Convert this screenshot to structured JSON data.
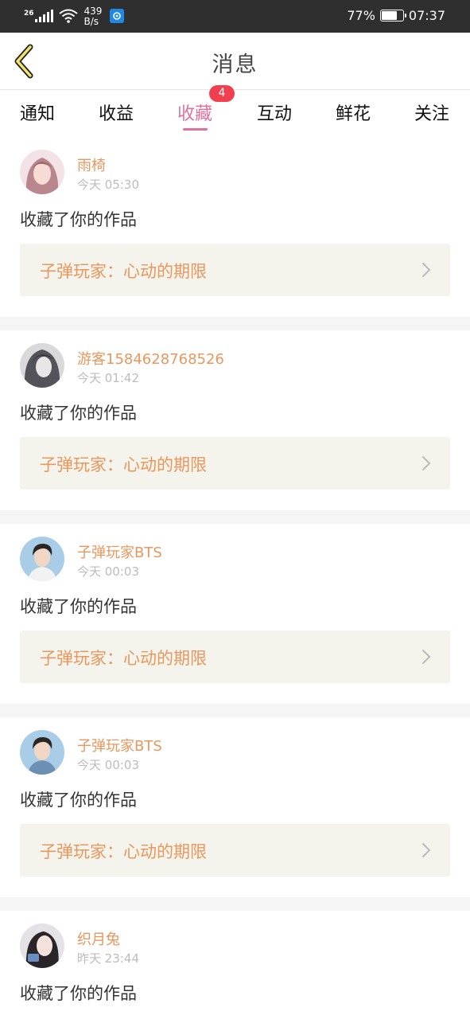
{
  "status_bar": {
    "network": "26",
    "speed_value": "439",
    "speed_unit": "B/s",
    "battery": "77%",
    "battery_level": 0.77,
    "time": "07:37"
  },
  "header": {
    "title": "消息",
    "back_icon": "chevron-left-icon"
  },
  "tabs": [
    {
      "label": "通知",
      "active": false
    },
    {
      "label": "收益",
      "active": false
    },
    {
      "label": "收藏",
      "active": true,
      "badge": "4"
    },
    {
      "label": "互动",
      "active": false
    },
    {
      "label": "鲜花",
      "active": false
    },
    {
      "label": "关注",
      "active": false
    }
  ],
  "colors": {
    "accent": "#e0719d",
    "badge": "#f23f4f",
    "username": "#e8975e",
    "work_bg": "#f4f4ec"
  },
  "messages": [
    {
      "user": "雨椅",
      "time": "今天 05:30",
      "action": "收藏了你的作品",
      "work": "子弹玩家：心动的期限"
    },
    {
      "user": "游客1584628768526",
      "time": "今天 01:42",
      "action": "收藏了你的作品",
      "work": "子弹玩家：心动的期限"
    },
    {
      "user": "子弹玩家BTS",
      "time": "今天 00:03",
      "action": "收藏了你的作品",
      "work": "子弹玩家：心动的期限"
    },
    {
      "user": "子弹玩家BTS",
      "time": "今天 00:03",
      "action": "收藏了你的作品",
      "work": "子弹玩家：心动的期限"
    },
    {
      "user": "织月兔",
      "time": "昨天 23:44",
      "action": "收藏了你的作品",
      "work": ""
    }
  ]
}
